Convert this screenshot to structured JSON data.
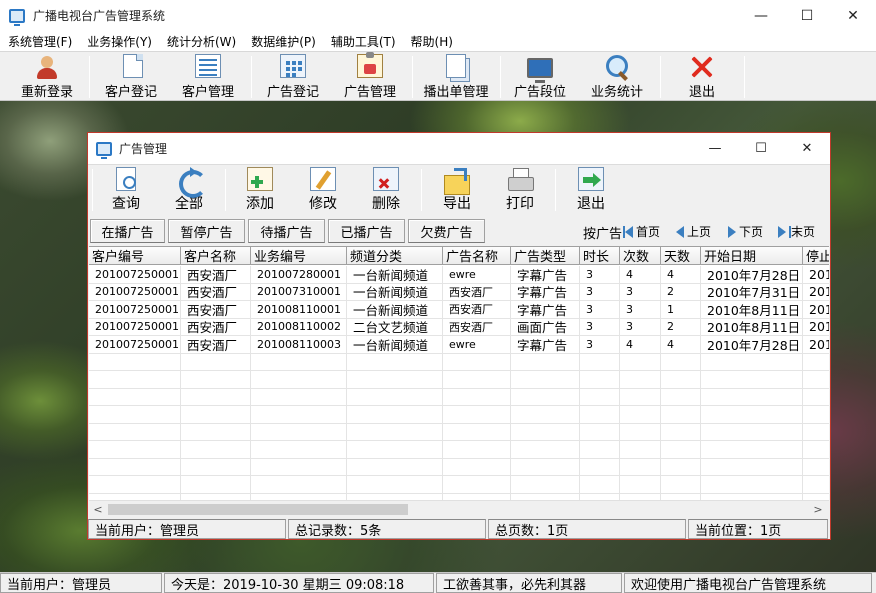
{
  "window": {
    "title": "广播电视台广告管理系统",
    "minimize": "—",
    "maximize": "☐",
    "close": "✕"
  },
  "menu": [
    "系统管理(F)",
    "业务操作(Y)",
    "统计分析(W)",
    "数据维护(P)",
    "辅助工具(T)",
    "帮助(H)"
  ],
  "toolbar": {
    "relogin": "重新登录",
    "customer_register": "客户登记",
    "customer_manage": "客户管理",
    "ad_register": "广告登记",
    "ad_manage": "广告管理",
    "broadcast_manage": "播出单管理",
    "ad_slot": "广告段位",
    "business_stats": "业务统计",
    "exit": "退出"
  },
  "child": {
    "title": "广告管理",
    "toolbar": {
      "query": "查询",
      "all": "全部",
      "add": "添加",
      "edit": "修改",
      "delete": "删除",
      "export": "导出",
      "print": "打印",
      "exit": "退出"
    },
    "tabs": [
      "在播广告",
      "暂停广告",
      "待播广告",
      "已播广告",
      "欠费广告"
    ],
    "nav": {
      "by_label": "按广告",
      "first": "首页",
      "prev": "上页",
      "next": "下页",
      "last": "末页"
    },
    "columns": [
      "客户编号",
      "客户名称",
      "业务编号",
      "频道分类",
      "广告名称",
      "广告类型",
      "时长",
      "次数",
      "天数",
      "开始日期",
      "停止"
    ],
    "rows": [
      [
        "201007250001",
        "西安酒厂",
        "201007280001",
        "一台新闻频道",
        "ewre",
        "字幕广告",
        "3",
        "4",
        "4",
        "2010年7月28日",
        "201"
      ],
      [
        "201007250001",
        "西安酒厂",
        "201007310001",
        "一台新闻频道",
        "西安酒厂",
        "字幕广告",
        "3",
        "3",
        "2",
        "2010年7月31日",
        "201"
      ],
      [
        "201007250001",
        "西安酒厂",
        "201008110001",
        "一台新闻频道",
        "西安酒厂",
        "字幕广告",
        "3",
        "3",
        "1",
        "2010年8月11日",
        "201"
      ],
      [
        "201007250001",
        "西安酒厂",
        "201008110002",
        "二台文艺频道",
        "西安酒厂",
        "画面广告",
        "3",
        "3",
        "2",
        "2010年8月11日",
        "201"
      ],
      [
        "201007250001",
        "西安酒厂",
        "201008110003",
        "一台新闻频道",
        "ewre",
        "字幕广告",
        "3",
        "4",
        "4",
        "2010年7月28日",
        "201"
      ]
    ],
    "status": {
      "user": "当前用户：管理员",
      "total": "总记录数：5条",
      "pages": "总页数：1页",
      "position": "当前位置：1页"
    }
  },
  "status": {
    "user": "当前用户：管理员",
    "today": "今天是：2019-10-30 星期三 09:08:18",
    "motto": "工欲善其事，必先利其器",
    "welcome": "欢迎使用广播电视台广告管理系统"
  }
}
